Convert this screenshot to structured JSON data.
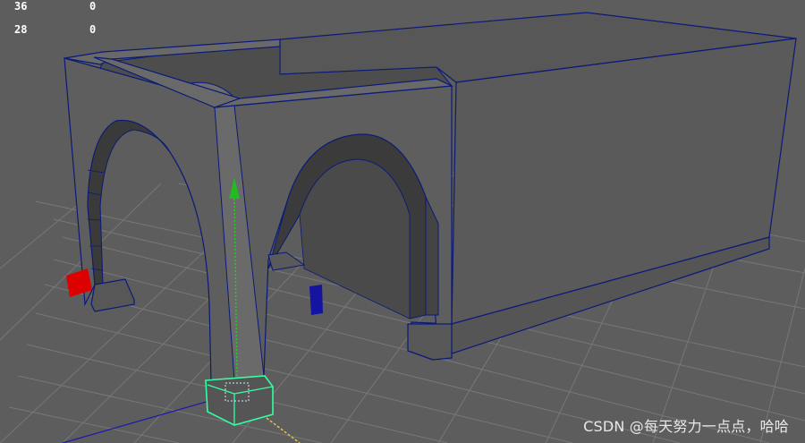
{
  "hud": {
    "rows": [
      {
        "label": "36",
        "value": "0"
      },
      {
        "label": "28",
        "value": "0"
      }
    ]
  },
  "watermark": "CSDN @每天努力一点点，哈哈",
  "colors": {
    "background": "#5d5d5d",
    "grid": "#7a7a7a",
    "mesh_face": "#5f5f5f",
    "mesh_dark": "#3f3f3f",
    "wire": "#0a1a78",
    "selection": "#33ffa0",
    "move_y_axis": "#22cc22",
    "light_red": "#dd0000",
    "light_blue": "#1414a0"
  },
  "icons": [
    "move-manipulator-icon",
    "light-locator-icon"
  ]
}
